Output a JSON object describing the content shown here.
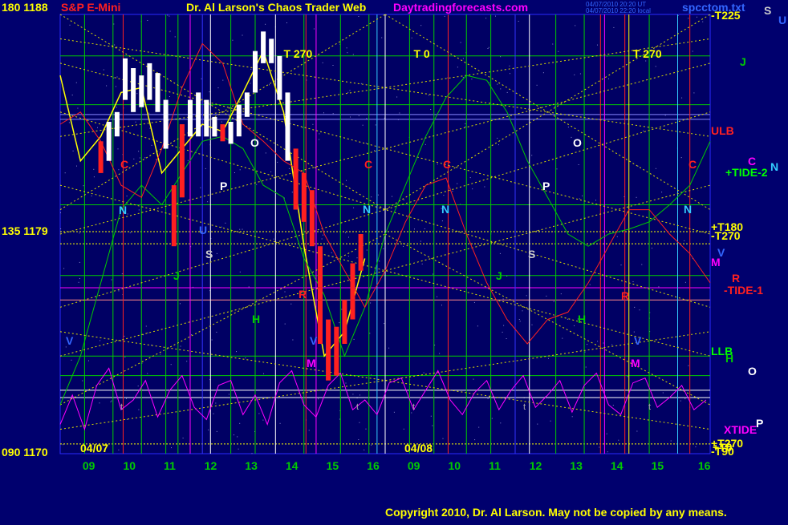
{
  "colors": {
    "background": "#00006e",
    "plot_bg": "#000066",
    "yellow": "#ffff00",
    "green": "#00cc00",
    "white": "#ffffff",
    "red": "#ff2020",
    "magenta": "#ff00ff",
    "blue": "#3333ff",
    "cyan": "#33ccff",
    "text_blue": "#3366ff"
  },
  "header": {
    "symbol": "S&P E-Mini",
    "title": "Dr. Al Larson's Chaos Trader Web",
    "website": "Daytradingforecasts.com",
    "timestamp1": "04/07/2010 20:20 UT",
    "timestamp2": "04/07/2010 22:20 local",
    "filename": "spcctom.txt"
  },
  "y_labels": {
    "top": "180 1188",
    "mid": "135 1179",
    "bottom": "090 1170"
  },
  "day_labels": [
    "04/07",
    "04/08"
  ],
  "tide_markers": [
    {
      "label": "T  270",
      "color": "#ffff00"
    },
    {
      "label": "T  0",
      "color": "#ffff00"
    },
    {
      "label": "T  270",
      "color": "#ffff00"
    }
  ],
  "right_labels": [
    {
      "text": "-T225",
      "color": "#ffff00"
    },
    {
      "text": "S",
      "color": "#cccccc"
    },
    {
      "text": "U",
      "color": "#3366ff"
    },
    {
      "text": "J",
      "color": "#00cc00"
    },
    {
      "text": "ULB",
      "color": "#ff2020"
    },
    {
      "text": "C",
      "color": "#ff00ff"
    },
    {
      "text": "+TIDE-2",
      "color": "#00ff00"
    },
    {
      "text": "N",
      "color": "#33ccff"
    },
    {
      "text": "+T180",
      "color": "#ffff00"
    },
    {
      "text": "-T270",
      "color": "#ffff00"
    },
    {
      "text": "V",
      "color": "#3366ff"
    },
    {
      "text": "M",
      "color": "#ff00ff"
    },
    {
      "text": "R",
      "color": "#ff2020"
    },
    {
      "text": "-TIDE-1",
      "color": "#ff2020"
    },
    {
      "text": "LLB",
      "color": "#00ff00"
    },
    {
      "text": "H",
      "color": "#00cc00"
    },
    {
      "text": "O",
      "color": "#ffffff"
    },
    {
      "text": "P",
      "color": "#ffffff"
    },
    {
      "text": "XTIDE",
      "color": "#ff00ff"
    },
    {
      "text": "+T270",
      "color": "#ffff00"
    },
    {
      "text": "+T0",
      "color": "#ffff00"
    },
    {
      "text": "-T90",
      "color": "#ffff00"
    }
  ],
  "planet_markers_day1": [
    {
      "t": "C",
      "c": "#ff2020"
    },
    {
      "t": "N",
      "c": "#33ccff"
    },
    {
      "t": "U",
      "c": "#3366ff"
    },
    {
      "t": "S",
      "c": "#cccccc"
    },
    {
      "t": "J",
      "c": "#00cc00"
    },
    {
      "t": "R",
      "c": "#ff2020"
    },
    {
      "t": "P",
      "c": "#ffffff"
    },
    {
      "t": "O",
      "c": "#ffffff"
    },
    {
      "t": "V",
      "c": "#3366ff"
    },
    {
      "t": "H",
      "c": "#00cc00"
    },
    {
      "t": "M",
      "c": "#ff00ff"
    },
    {
      "t": "C",
      "c": "#ff2020"
    },
    {
      "t": "N",
      "c": "#33ccff"
    },
    {
      "t": "V",
      "c": "#3366ff"
    }
  ],
  "planet_markers_day2": [
    {
      "t": "C",
      "c": "#ff2020"
    },
    {
      "t": "N",
      "c": "#33ccff"
    },
    {
      "t": "P",
      "c": "#ffffff"
    },
    {
      "t": "S",
      "c": "#cccccc"
    },
    {
      "t": "J",
      "c": "#00cc00"
    },
    {
      "t": "O",
      "c": "#ffffff"
    },
    {
      "t": "H",
      "c": "#00cc00"
    },
    {
      "t": "R",
      "c": "#ff2020"
    },
    {
      "t": "V",
      "c": "#3366ff"
    },
    {
      "t": "M",
      "c": "#ff00ff"
    },
    {
      "t": "N",
      "c": "#33ccff"
    },
    {
      "t": "C",
      "c": "#ff2020"
    }
  ],
  "tiny_t_labels": [
    "t",
    "t",
    "t",
    "t",
    "t"
  ],
  "footer": {
    "copyright": "Copyright 2010, Dr. Al Larson. May not be copied by any means."
  },
  "chart_data": {
    "type": "line",
    "ylim": [
      1170,
      1188
    ],
    "x_ticks": [
      "09",
      "10",
      "11",
      "12",
      "13",
      "14",
      "15",
      "16",
      "09",
      "10",
      "11",
      "12",
      "13",
      "14",
      "15",
      "16"
    ],
    "price_bars_day1": [
      {
        "x": 9.0,
        "lo": 1181.5,
        "hi": 1182.8
      },
      {
        "x": 9.2,
        "lo": 1182.0,
        "hi": 1183.6
      },
      {
        "x": 9.4,
        "lo": 1183.0,
        "hi": 1184.0
      },
      {
        "x": 9.6,
        "lo": 1184.5,
        "hi": 1186.2
      },
      {
        "x": 9.8,
        "lo": 1184.0,
        "hi": 1185.8
      },
      {
        "x": 10.0,
        "lo": 1184.2,
        "hi": 1185.5
      },
      {
        "x": 10.2,
        "lo": 1184.5,
        "hi": 1186.0
      },
      {
        "x": 10.4,
        "lo": 1184.0,
        "hi": 1185.6
      },
      {
        "x": 10.6,
        "lo": 1182.5,
        "hi": 1184.5
      },
      {
        "x": 10.8,
        "lo": 1178.5,
        "hi": 1181.0
      },
      {
        "x": 11.0,
        "lo": 1180.5,
        "hi": 1183.5
      },
      {
        "x": 11.2,
        "lo": 1183.0,
        "hi": 1184.5
      },
      {
        "x": 11.4,
        "lo": 1183.0,
        "hi": 1184.8
      },
      {
        "x": 11.6,
        "lo": 1183.0,
        "hi": 1184.5
      },
      {
        "x": 11.8,
        "lo": 1183.0,
        "hi": 1183.8
      },
      {
        "x": 12.0,
        "lo": 1182.8,
        "hi": 1183.5
      },
      {
        "x": 12.2,
        "lo": 1182.7,
        "hi": 1183.6
      },
      {
        "x": 12.4,
        "lo": 1183.0,
        "hi": 1184.3
      },
      {
        "x": 12.6,
        "lo": 1183.8,
        "hi": 1184.8
      },
      {
        "x": 12.8,
        "lo": 1184.8,
        "hi": 1186.5
      },
      {
        "x": 13.0,
        "lo": 1186.0,
        "hi": 1187.3
      },
      {
        "x": 13.2,
        "lo": 1186.0,
        "hi": 1187.0
      },
      {
        "x": 13.4,
        "lo": 1184.5,
        "hi": 1186.3
      },
      {
        "x": 13.6,
        "lo": 1182.0,
        "hi": 1184.8
      },
      {
        "x": 13.8,
        "lo": 1180.0,
        "hi": 1182.5
      },
      {
        "x": 14.0,
        "lo": 1179.5,
        "hi": 1181.5
      },
      {
        "x": 14.2,
        "lo": 1178.5,
        "hi": 1180.8
      },
      {
        "x": 14.4,
        "lo": 1174.5,
        "hi": 1178.5
      },
      {
        "x": 14.6,
        "lo": 1173.0,
        "hi": 1175.5
      },
      {
        "x": 14.8,
        "lo": 1173.2,
        "hi": 1175.2
      },
      {
        "x": 15.0,
        "lo": 1174.5,
        "hi": 1176.3
      },
      {
        "x": 15.2,
        "lo": 1175.5,
        "hi": 1177.8
      },
      {
        "x": 15.4,
        "lo": 1177.5,
        "hi": 1179.0
      }
    ],
    "series": [
      {
        "color": "#ffff00",
        "x": [
          8.0,
          8.5,
          9.0,
          9.5,
          10.0,
          10.5,
          11.0,
          11.5,
          12.0,
          12.5,
          13.0,
          13.5,
          14.0,
          14.5,
          15.0,
          15.5
        ],
        "y": [
          1185.5,
          1182.0,
          1183.0,
          1184.8,
          1185.0,
          1181.5,
          1182.5,
          1183.5,
          1183.2,
          1184.8,
          1186.5,
          1184.0,
          1178.5,
          1174.0,
          1175.0,
          1178.0
        ]
      },
      {
        "color": "#00cc00",
        "x": [
          8.0,
          8.5,
          9.0,
          9.5,
          10.0,
          10.5,
          11.0,
          11.5,
          12.0,
          12.5,
          13.0,
          13.5,
          14.0,
          14.5,
          15.0,
          15.5,
          16.0,
          16.5,
          17.0,
          17.5,
          18.0,
          18.5,
          19.0,
          19.5,
          20.0,
          20.5,
          21.0,
          21.5,
          22.0,
          22.5,
          23.0,
          23.5,
          24.0
        ],
        "y": [
          1172.0,
          1174.0,
          1177.0,
          1180.0,
          1181.0,
          1180.2,
          1181.5,
          1182.8,
          1183.0,
          1182.5,
          1181.0,
          1180.5,
          1178.0,
          1176.5,
          1174.0,
          1176.0,
          1179.0,
          1181.0,
          1183.0,
          1184.6,
          1185.5,
          1185.3,
          1184.0,
          1182.0,
          1180.5,
          1179.0,
          1178.5,
          1179.0,
          1179.2,
          1179.5,
          1180.2,
          1181.0,
          1182.8
        ]
      },
      {
        "color": "#ff2020",
        "x": [
          8.0,
          8.5,
          9.0,
          9.5,
          10.0,
          10.5,
          11.0,
          11.5,
          12.0,
          12.5,
          13.0,
          13.5,
          14.0,
          14.5,
          15.0,
          15.5,
          16.0,
          16.5,
          17.0,
          17.5,
          18.0,
          18.5,
          19.0,
          19.5,
          20.0,
          20.5,
          21.0,
          21.5,
          22.0,
          22.5,
          23.0,
          23.5,
          24.0
        ],
        "y": [
          1183.5,
          1184.0,
          1182.8,
          1181.0,
          1180.5,
          1182.5,
          1185.0,
          1186.8,
          1186.0,
          1183.5,
          1182.8,
          1182.0,
          1181.5,
          1179.0,
          1177.5,
          1176.0,
          1177.5,
          1179.5,
          1181.0,
          1181.3,
          1179.0,
          1177.0,
          1175.5,
          1174.5,
          1175.5,
          1175.8,
          1177.0,
          1178.5,
          1180.0,
          1180.0,
          1179.0,
          1178.2,
          1177.0
        ]
      },
      {
        "color": "#ff00ff",
        "x": [
          8.0,
          8.3,
          8.6,
          8.9,
          9.2,
          9.5,
          9.8,
          10.1,
          10.4,
          10.7,
          11.0,
          11.3,
          11.6,
          11.9,
          12.2,
          12.5,
          12.8,
          13.1,
          13.4,
          13.7,
          14.0,
          14.3,
          14.6,
          14.9,
          15.2,
          15.5,
          15.8,
          16.1,
          16.4,
          16.7,
          17.0,
          17.3,
          17.6,
          17.9,
          18.2,
          18.5,
          18.8,
          19.1,
          19.4,
          19.7,
          20.0,
          20.3,
          20.6,
          20.9,
          21.2,
          21.5,
          21.8,
          22.1,
          22.4,
          22.7,
          23.0,
          23.3,
          23.6,
          23.9
        ],
        "y": [
          1171.2,
          1172.4,
          1171.0,
          1172.8,
          1173.5,
          1171.8,
          1172.2,
          1173.0,
          1171.5,
          1172.6,
          1173.2,
          1171.9,
          1171.4,
          1172.8,
          1173.0,
          1171.6,
          1172.4,
          1171.2,
          1172.9,
          1173.4,
          1172.0,
          1171.5,
          1172.8,
          1173.3,
          1171.8,
          1172.2,
          1171.6,
          1172.9,
          1173.1,
          1171.8,
          1172.6,
          1173.4,
          1172.2,
          1171.6,
          1172.5,
          1173.0,
          1171.8,
          1172.6,
          1173.2,
          1171.9,
          1172.4,
          1173.0,
          1171.7,
          1172.8,
          1173.3,
          1172.0,
          1171.6,
          1172.9,
          1173.1,
          1171.9,
          1172.3,
          1172.8,
          1171.8,
          1172.2
        ]
      }
    ]
  }
}
